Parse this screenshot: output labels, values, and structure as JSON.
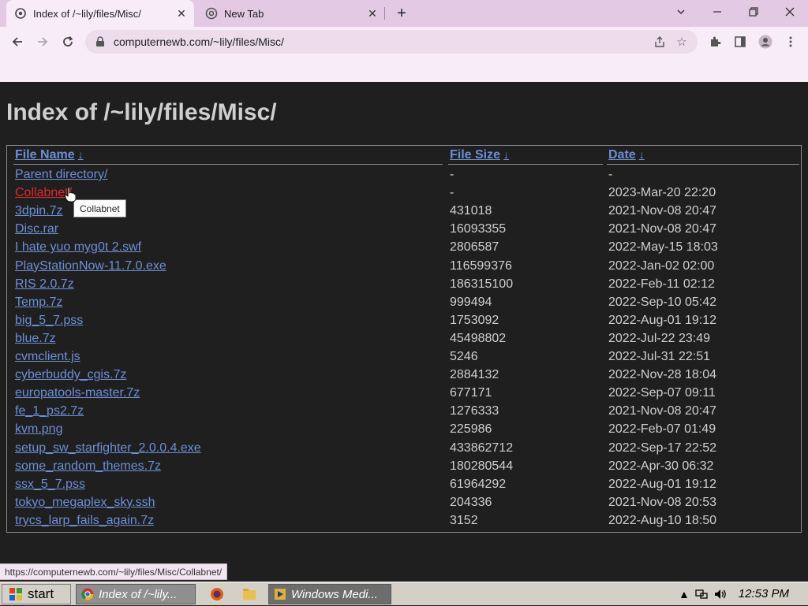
{
  "browser": {
    "tabs": [
      {
        "title": "Index of /~lily/files/Misc/",
        "active": true
      },
      {
        "title": "New Tab",
        "active": false
      }
    ],
    "new_tab": "+",
    "url": "computernewb.com/~lily/files/Misc/"
  },
  "page": {
    "heading": "Index of /~lily/files/Misc/",
    "columns": {
      "name": "File Name",
      "size": "File Size",
      "date": "Date",
      "sort_arrow": "↓"
    },
    "rows": [
      {
        "name": "Parent directory/",
        "size": "-",
        "date": "-"
      },
      {
        "name": "Collabnet/",
        "size": "-",
        "date": "2023-Mar-20 22:20"
      },
      {
        "name": "3dpin.7z",
        "size": "431018",
        "date": "2021-Nov-08 20:47"
      },
      {
        "name": "Disc.rar",
        "size": "16093355",
        "date": "2021-Nov-08 20:47"
      },
      {
        "name": "I hate yuo myg0t 2.swf",
        "size": "2806587",
        "date": "2022-May-15 18:03"
      },
      {
        "name": "PlayStationNow-11.7.0.exe",
        "size": "116599376",
        "date": "2022-Jan-02 02:00"
      },
      {
        "name": "RIS 2.0.7z",
        "size": "186315100",
        "date": "2022-Feb-11 02:12"
      },
      {
        "name": "Temp.7z",
        "size": "999494",
        "date": "2022-Sep-10 05:42"
      },
      {
        "name": "big_5_7.pss",
        "size": "1753092",
        "date": "2022-Aug-01 19:12"
      },
      {
        "name": "blue.7z",
        "size": "45498802",
        "date": "2022-Jul-22 23:49"
      },
      {
        "name": "cvmclient.js",
        "size": "5246",
        "date": "2022-Jul-31 22:51"
      },
      {
        "name": "cyberbuddy_cgis.7z",
        "size": "2884132",
        "date": "2022-Nov-28 18:04"
      },
      {
        "name": "europatools-master.7z",
        "size": "677171",
        "date": "2022-Sep-07 09:11"
      },
      {
        "name": "fe_1_ps2.7z",
        "size": "1276333",
        "date": "2021-Nov-08 20:47"
      },
      {
        "name": "kvm.png",
        "size": "225986",
        "date": "2022-Feb-07 01:49"
      },
      {
        "name": "setup_sw_starfighter_2.0.0.4.exe",
        "size": "433862712",
        "date": "2022-Sep-17 22:52"
      },
      {
        "name": "some_random_themes.7z",
        "size": "180280544",
        "date": "2022-Apr-30 06:32"
      },
      {
        "name": "ssx_5_7.pss",
        "size": "61964292",
        "date": "2022-Aug-01 19:12"
      },
      {
        "name": "tokyo_megaplex_sky.ssh",
        "size": "204336",
        "date": "2021-Nov-08 20:53"
      },
      {
        "name": "trycs_larp_fails_again.7z",
        "size": "3152",
        "date": "2022-Aug-10 18:50"
      }
    ],
    "tooltip": "Collabnet",
    "hovered_row": 1
  },
  "status_url": "https://computernewb.com/~lily/files/Misc/Collabnet/",
  "taskbar": {
    "start_label": "start",
    "buttons": [
      {
        "label": "Index of /~lily...",
        "icon": "chrome-icon",
        "active": true
      },
      {
        "label": "Windows Medi...",
        "icon": "media-player-icon",
        "active": false
      }
    ],
    "clock": "12:53 PM"
  },
  "colors": {
    "link": "#6d8fd8",
    "hover_link": "#e02828",
    "page_bg": "#1f1f1f",
    "tab_strip": "#e3c9e3"
  }
}
